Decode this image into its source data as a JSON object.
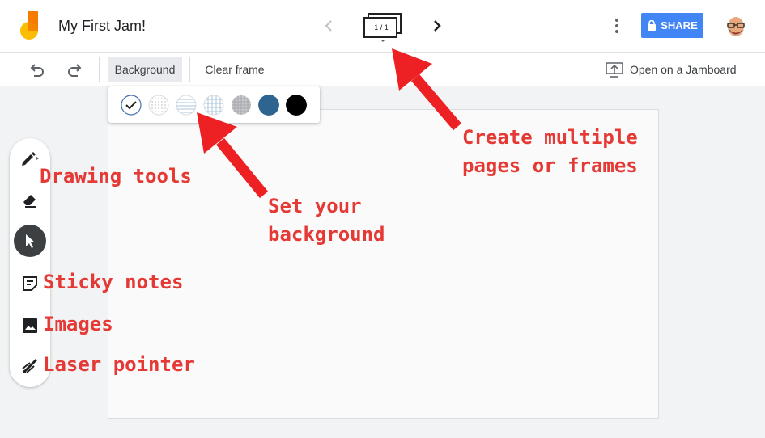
{
  "header": {
    "title": "My First Jam!",
    "frame_count": "1 / 1",
    "share_label": "SHARE"
  },
  "toolbar": {
    "background_label": "Background",
    "clear_frame_label": "Clear frame",
    "open_jamboard_label": "Open on a Jamboard"
  },
  "background_options": [
    {
      "name": "blank",
      "selected": true
    },
    {
      "name": "dots",
      "selected": false
    },
    {
      "name": "lines",
      "selected": false
    },
    {
      "name": "squares",
      "selected": false
    },
    {
      "name": "grid-dark",
      "selected": false
    },
    {
      "name": "blue",
      "color": "#2d6590",
      "selected": false
    },
    {
      "name": "black",
      "color": "#000000",
      "selected": false
    }
  ],
  "side_tools": [
    {
      "name": "pen",
      "icon": "pen-icon"
    },
    {
      "name": "eraser",
      "icon": "eraser-icon"
    },
    {
      "name": "select",
      "icon": "cursor-icon",
      "active": true
    },
    {
      "name": "sticky-note",
      "icon": "sticky-note-icon"
    },
    {
      "name": "image",
      "icon": "image-icon"
    },
    {
      "name": "laser",
      "icon": "laser-icon"
    }
  ],
  "annotations": {
    "drawing_tools": "Drawing tools",
    "sticky_notes": "Sticky notes",
    "images": "Images",
    "laser_pointer": "Laser pointer",
    "set_background_line1": "Set your",
    "set_background_line2": "background",
    "create_frames_line1": "Create multiple",
    "create_frames_line2": "pages or frames"
  },
  "colors": {
    "share_blue": "#4285f4",
    "annotation_red": "#e53935",
    "logo_orange": "#f57c00",
    "logo_yellow": "#fbbc04"
  }
}
